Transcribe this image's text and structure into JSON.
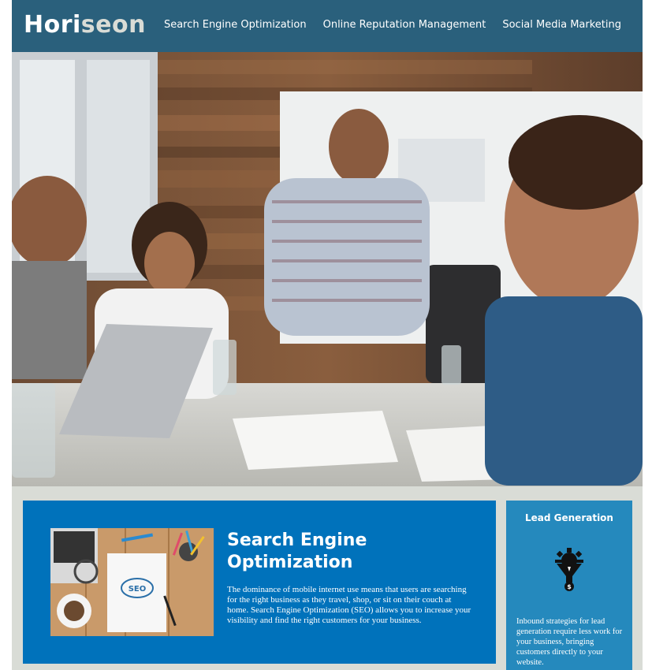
{
  "header": {
    "logo_main": "Hori",
    "logo_accent": "seon",
    "nav": [
      {
        "label": "Search Engine Optimization"
      },
      {
        "label": "Online Reputation Management"
      },
      {
        "label": "Social Media Marketing"
      }
    ]
  },
  "hero": {
    "image": "business-team-meeting-photo"
  },
  "seo": {
    "image": "seo-desk-notebook-photo",
    "title": "Search Engine Optimization",
    "text": "The dominance of mobile internet use means that users are searching for the right business as they travel, shop, or sit on their couch at home. Search Engine Optimization (SEO) allows you to increase your visibility and find the right customers for your business."
  },
  "lead": {
    "title": "Lead Generation",
    "icon": "lead-generation-funnel-icon",
    "text": "Inbound strategies for lead generation require less work for your business, bringing customers directly to your website."
  },
  "colors": {
    "header_bg": "#2a607c",
    "page_bg": "#d9dcd6",
    "seo_bg": "#0072bb",
    "lead_bg": "#2589bd",
    "logo_accent": "#d9dcd6"
  }
}
